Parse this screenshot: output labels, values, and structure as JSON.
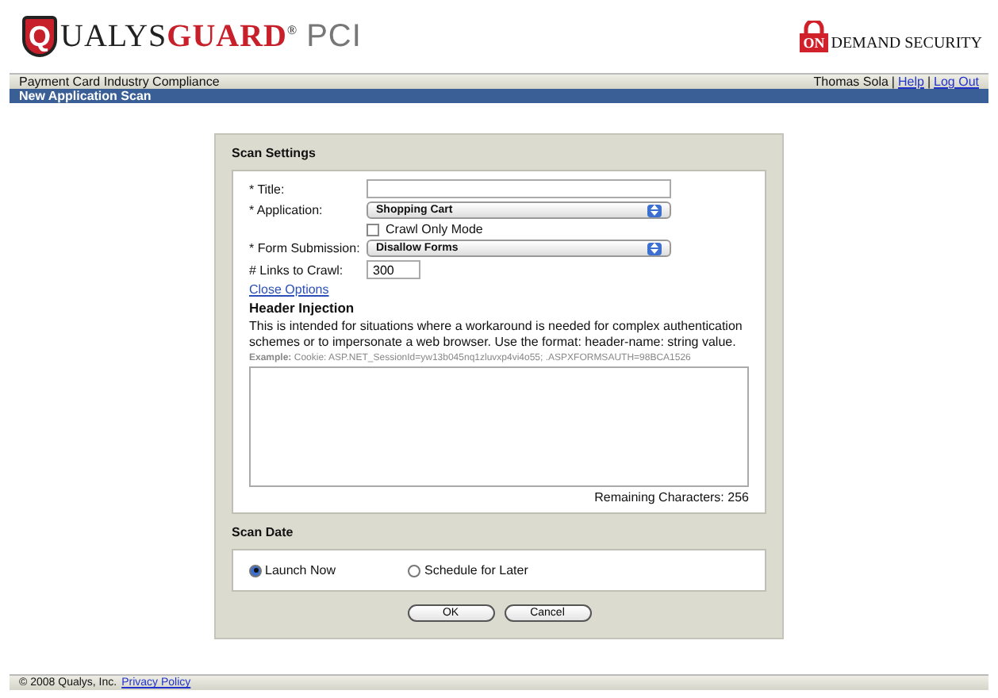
{
  "header": {
    "logo_letter": "Q",
    "logo_text": "UALYS",
    "logo_bold": "GUARD",
    "logo_reg": "®",
    "logo_suffix": "PCI",
    "partner_on": "ON",
    "partner_text": "DEMAND SECURITY"
  },
  "nav": {
    "title": "Payment Card Industry Compliance",
    "user": "Thomas Sola",
    "links": [
      "Help",
      "Log Out"
    ],
    "separator": "|"
  },
  "page_title": "New Application Scan",
  "scan_settings": {
    "heading": "Scan Settings",
    "fields": [
      {
        "kind": "text",
        "label": "* Title:"
      },
      {
        "kind": "select",
        "label": "* Application:",
        "value": "Shopping Cart"
      },
      {
        "kind": "checkbox",
        "label": "Crawl Only Mode",
        "checked": false
      },
      {
        "kind": "select",
        "label": "* Form Submission:",
        "value": "Disallow Forms"
      },
      {
        "kind": "short",
        "label": "# Links to Crawl:",
        "value": "300"
      }
    ],
    "close_options": "Close Options",
    "header_injection": {
      "heading": "Header Injection",
      "description": "This is intended for situations where a workaround is needed for complex authentication schemes or to impersonate a web browser. Use the format: header-name: string value.",
      "example": "**Example:** Cookie: ASP.NET_SessionId=yw13b045nq1zluvxp4vi4o55; .ASPXFORMSAUTH=98BCA1526",
      "remaining_label": "Remaining Characters:",
      "remaining": "256"
    }
  },
  "scan_date": {
    "heading": "Scan Date",
    "options": [
      {
        "label": "Launch Now",
        "selected": true
      },
      {
        "label": "Schedule for Later",
        "selected": false
      }
    ]
  },
  "buttons": [
    "OK",
    "Cancel"
  ],
  "footer": {
    "copyright": "© 2008 Qualys, Inc.",
    "link": "Privacy Policy"
  }
}
